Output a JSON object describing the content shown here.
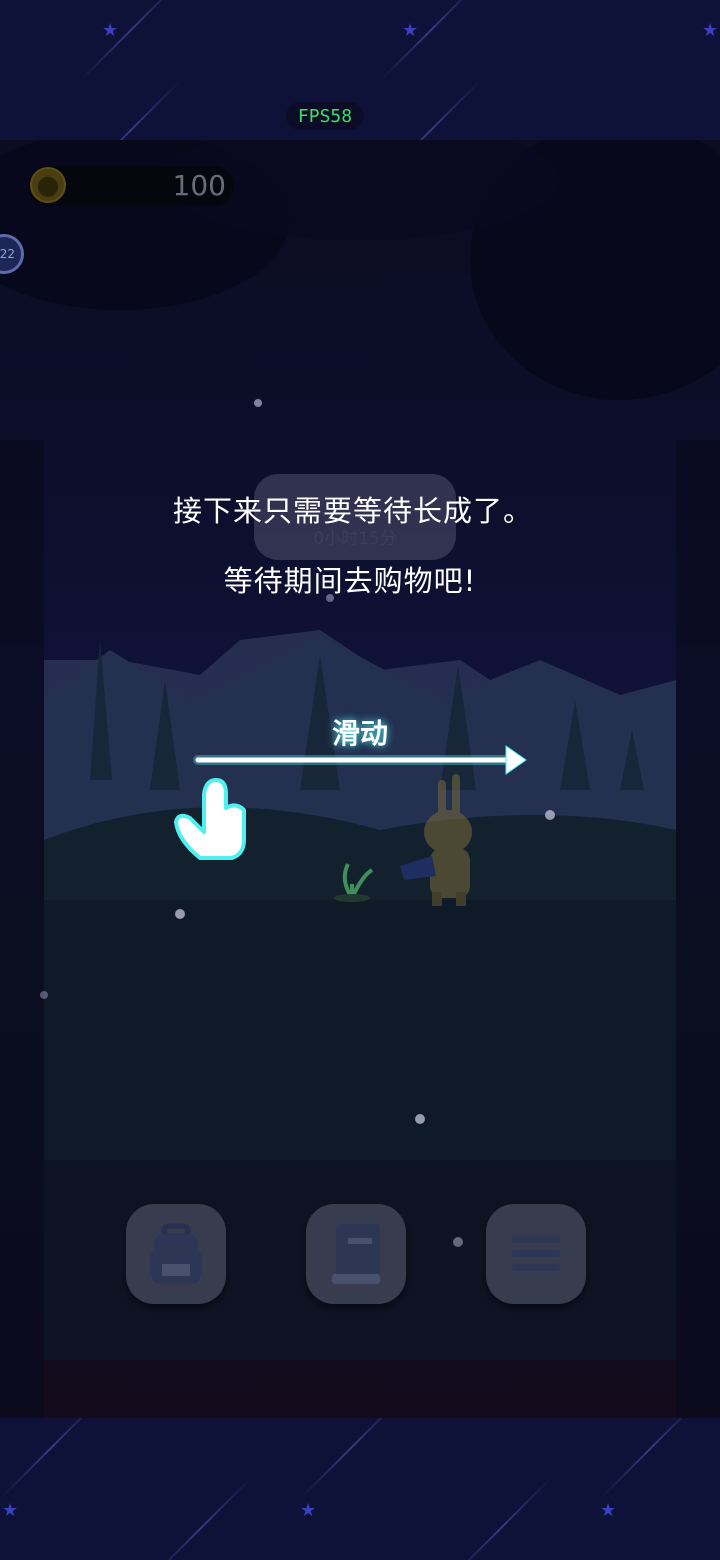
{
  "hud": {
    "fps": "FPS58",
    "coins": "100",
    "level": "22"
  },
  "timer": {
    "remaining": "0小时15分"
  },
  "tutorial": {
    "line1": "接下来只需要等待长成了。",
    "line2": "等待期间去购物吧!",
    "swipe_label": "滑动"
  },
  "bottom_buttons": [
    {
      "name": "backpack",
      "icon": "backpack-icon"
    },
    {
      "name": "book",
      "icon": "book-icon"
    },
    {
      "name": "menu",
      "icon": "hamburger-menu-icon"
    }
  ],
  "colors": {
    "fps_text": "#3fdc6a",
    "tutorial_text": "#ffffff",
    "glow": "#4ff0f0",
    "star": "#3b3fc0"
  }
}
